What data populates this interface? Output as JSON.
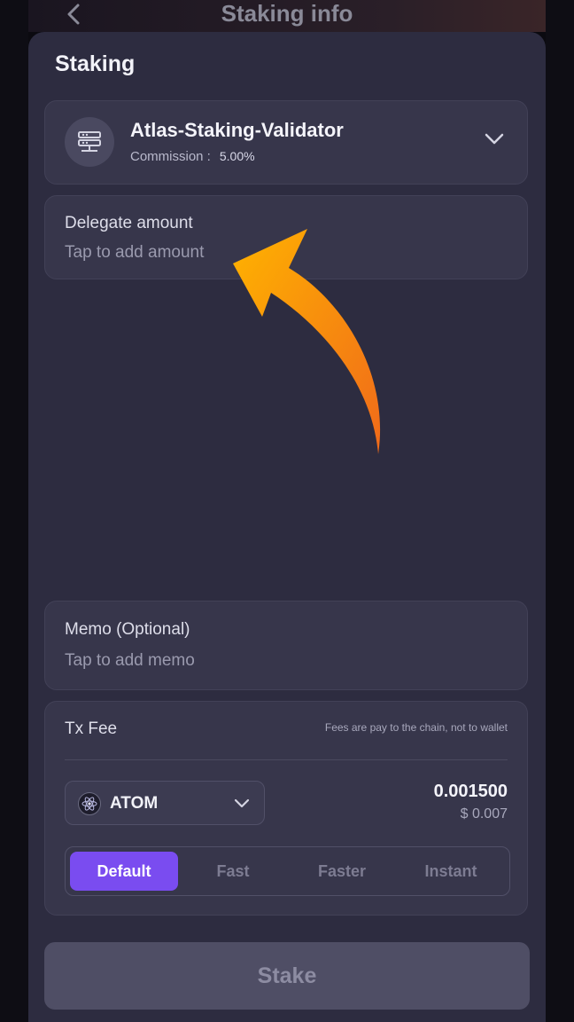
{
  "header": {
    "title": "Staking info"
  },
  "sheet": {
    "title": "Staking"
  },
  "validator": {
    "name": "Atlas-Staking-Validator",
    "commission_label": "Commission :",
    "commission_value": "5.00%"
  },
  "delegate": {
    "label": "Delegate amount",
    "placeholder": "Tap to add amount"
  },
  "memo": {
    "label": "Memo (Optional)",
    "placeholder": "Tap to add memo"
  },
  "tx_fee": {
    "label": "Tx Fee",
    "note": "Fees are pay to the chain, not to wallet",
    "token": "ATOM",
    "amount": "0.001500",
    "usd": "$ 0.007",
    "speeds": [
      "Default",
      "Fast",
      "Faster",
      "Instant"
    ],
    "selected_speed": "Default"
  },
  "stake_button": {
    "label": "Stake"
  },
  "colors": {
    "accent": "#7a4cf0",
    "arrow_start": "#ffb300",
    "arrow_end": "#f06a1a"
  }
}
